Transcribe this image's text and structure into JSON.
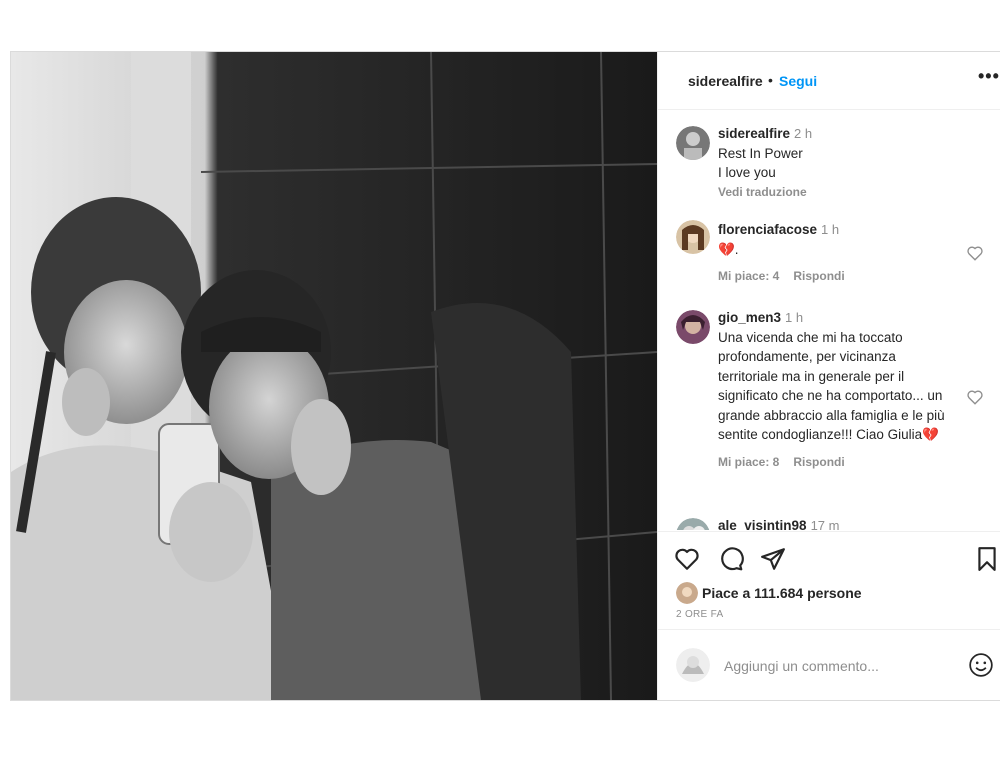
{
  "header": {
    "username": "siderealfire",
    "separator": "•",
    "follow_label": "Segui",
    "more_label": "•••"
  },
  "comments": [
    {
      "username": "siderealfire",
      "time": "2 h",
      "lines": [
        "Rest In Power",
        "I love you"
      ],
      "translate_label": "Vedi traduzione"
    },
    {
      "username": "florenciafacose",
      "time": "1 h",
      "text": "💔.",
      "likes_label": "Mi piace: 4",
      "reply_label": "Rispondi"
    },
    {
      "username": "gio_men3",
      "time": "1 h",
      "text": "Una vicenda che mi ha toccato profondamente, per vicinanza territoriale ma in generale per il significato che ne ha comportato... un grande abbraccio alla famiglia e le più sentite condoglianze!!! Ciao Giulia💔",
      "likes_label": "Mi piace: 8",
      "reply_label": "Rispondi"
    },
    {
      "username": "ale_visintin98",
      "time": "17 m"
    }
  ],
  "actions": {
    "likes_text": "Piace a 111.684 persone",
    "posted_ago": "2 ORE FA",
    "comment_placeholder": "Aggiungi un commento..."
  },
  "icons": {
    "like": "heart-icon",
    "comment": "comment-bubble-icon",
    "share": "paper-plane-icon",
    "save": "bookmark-icon",
    "emoji": "smiley-icon",
    "comment_like": "heart-outline-icon"
  },
  "colors": {
    "accent": "#0095f6",
    "text": "#262626",
    "muted": "#8e8e8e",
    "border": "#dbdbdb"
  }
}
